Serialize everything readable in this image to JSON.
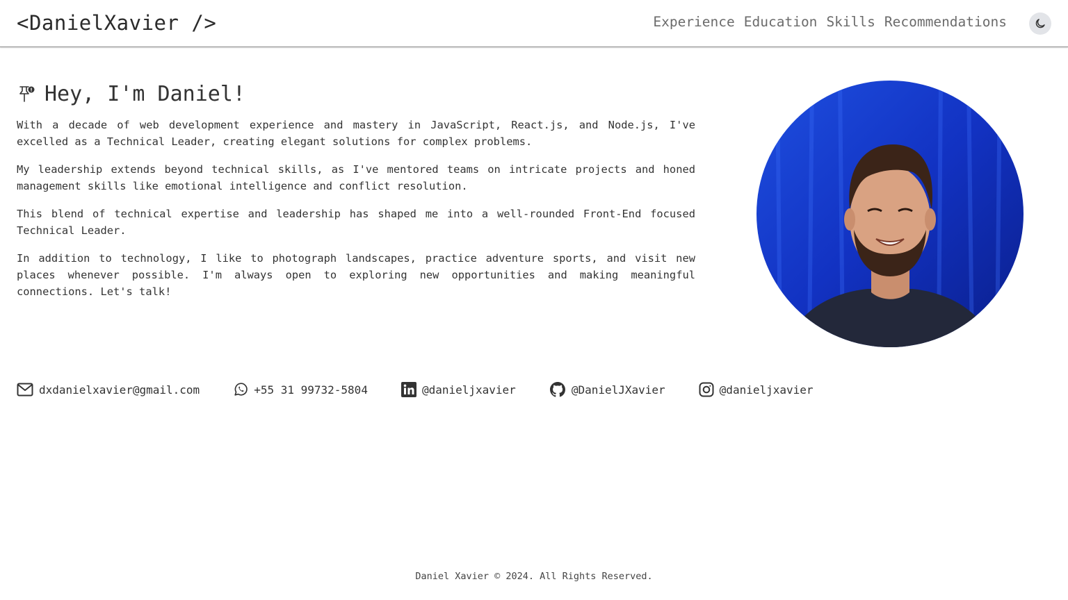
{
  "header": {
    "logo": "<DanielXavier />",
    "nav": [
      "Experience",
      "Education",
      "Skills",
      "Recommendations"
    ],
    "theme_toggle_icon": "moon-icon"
  },
  "hero": {
    "title": "Hey, I'm Daniel!",
    "title_icon": "pin-icon",
    "paragraphs": [
      "With a decade of web development experience and mastery in JavaScript, React.js, and Node.js, I've excelled as a Technical Leader, creating elegant solutions for complex problems.",
      "My leadership extends beyond technical skills, as I've mentored teams on intricate projects and honed management skills like emotional intelligence and conflict resolution.",
      "This blend of technical expertise and leadership has shaped me into a well-rounded Front-End focused Technical Leader.",
      "In addition to technology, I like to photograph landscapes, practice adventure sports, and visit new places whenever possible. I'm always open to exploring new opportunities and making meaningful connections. Let's talk!"
    ],
    "avatar_bg": "#1437c8"
  },
  "contacts": [
    {
      "icon": "mail-icon",
      "label": "dxdanielxavier@gmail.com"
    },
    {
      "icon": "whatsapp-icon",
      "label": "+55 31 99732-5804"
    },
    {
      "icon": "linkedin-icon",
      "label": "@danieljxavier"
    },
    {
      "icon": "github-icon",
      "label": "@DanielJXavier"
    },
    {
      "icon": "instagram-icon",
      "label": "@danieljxavier"
    }
  ],
  "footer": {
    "text": "Daniel Xavier © 2024. All Rights Reserved."
  }
}
